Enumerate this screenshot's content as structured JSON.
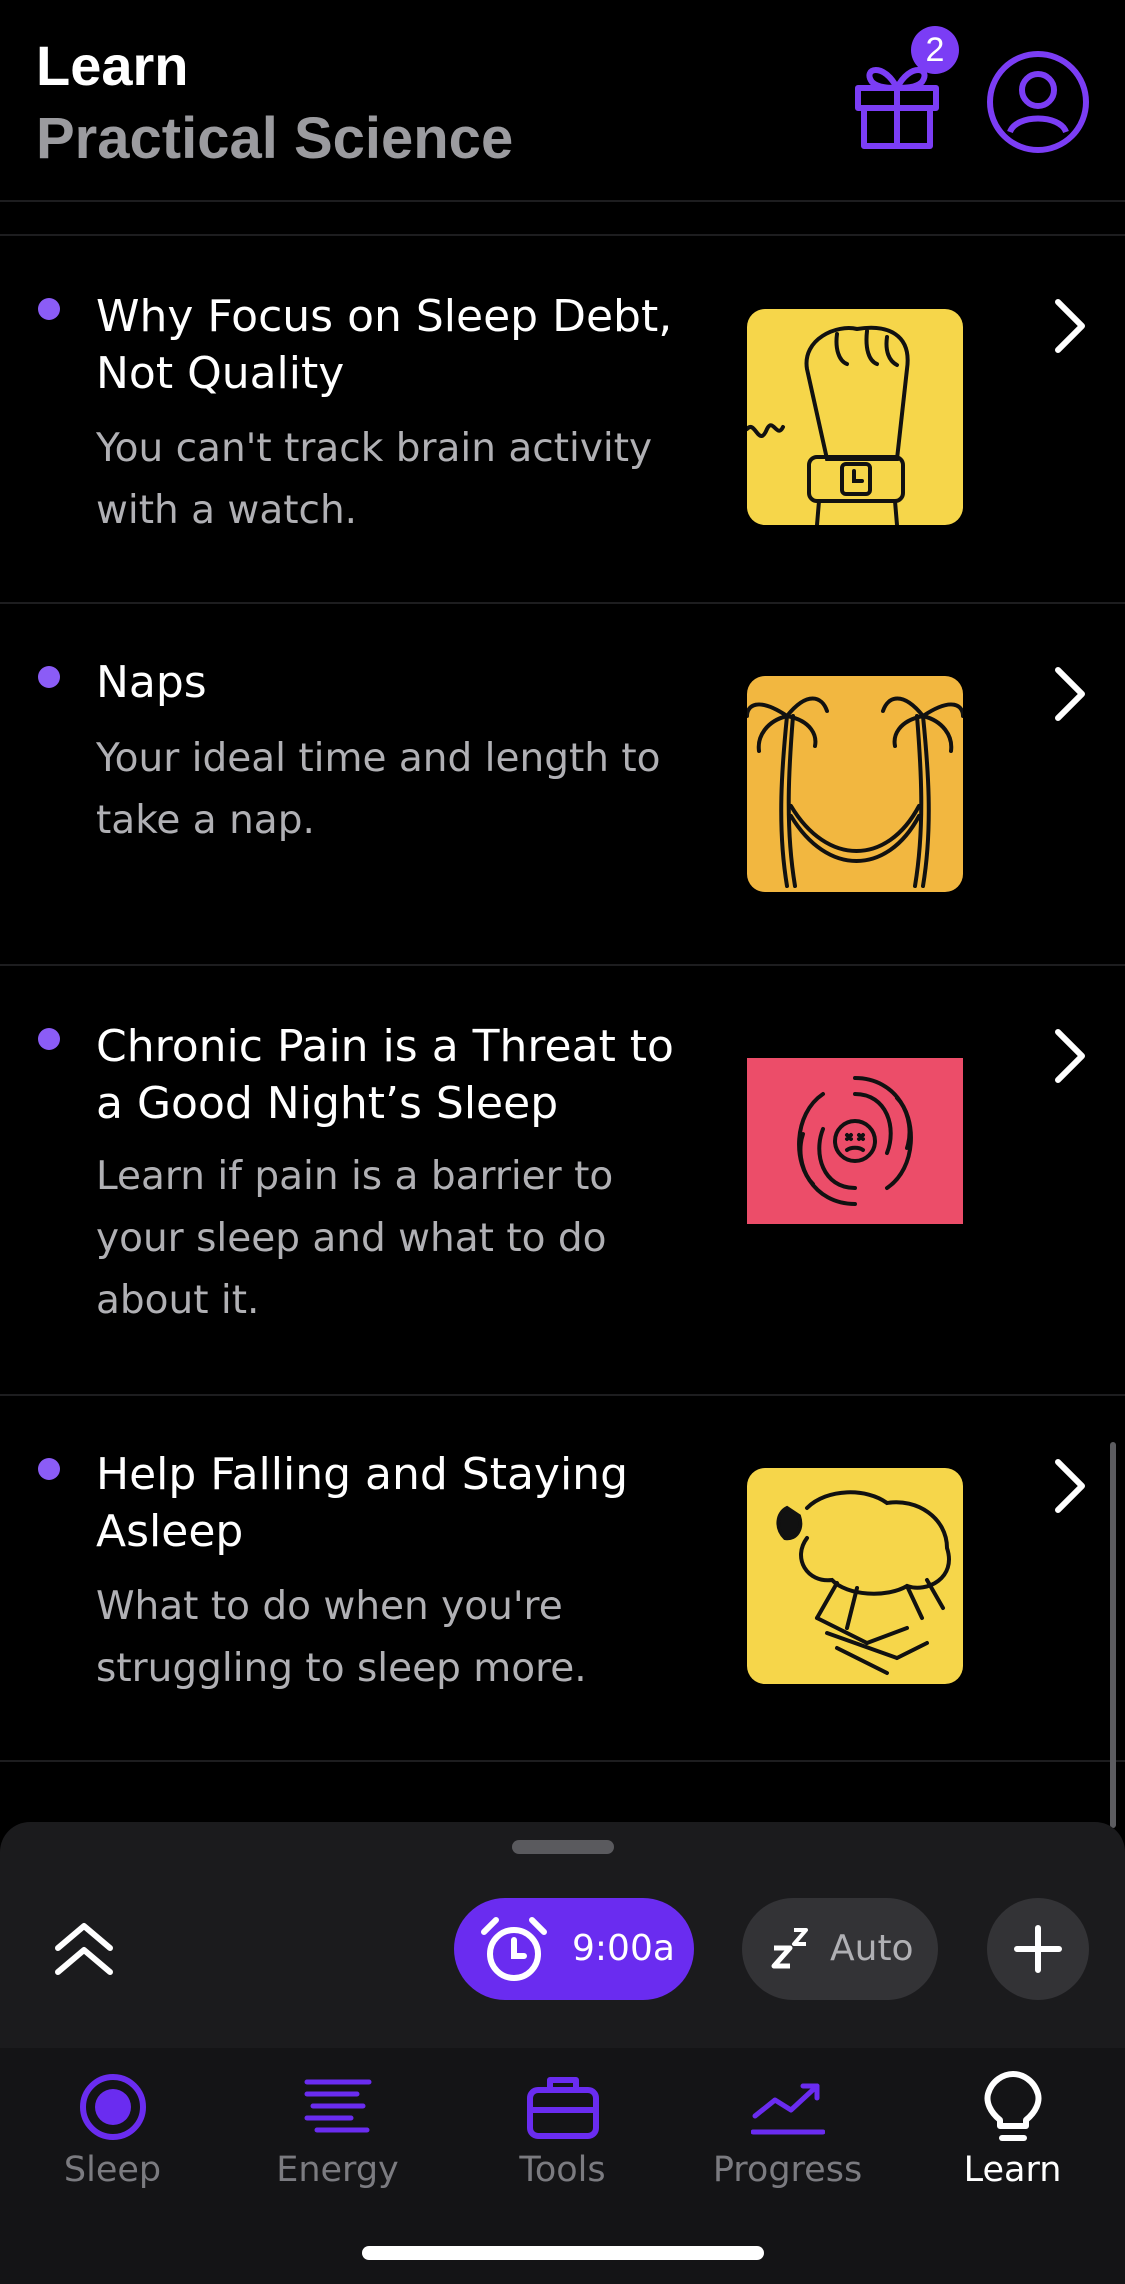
{
  "header": {
    "title": "Learn",
    "subtitle": "Practical Science",
    "gift_badge": "2",
    "accent_color": "#7b3df5"
  },
  "articles": [
    {
      "title": "Why Focus on Sleep Debt, Not Quality",
      "description": "You can't track brain activity with a watch.",
      "thumbnail_icon": "wrist-watch-illustration",
      "thumbnail_color": "#f6d64a"
    },
    {
      "title": "Naps",
      "description": "Your ideal time and length to take a nap.",
      "thumbnail_icon": "hammock-palm-trees-illustration",
      "thumbnail_color": "#f2b740"
    },
    {
      "title": "Chronic Pain is a Threat to a Good Night’s Sleep",
      "description": "Learn if pain is a barrier to your sleep and what to do about it.",
      "thumbnail_icon": "pain-swirl-illustration",
      "thumbnail_color": "#ec4d69"
    },
    {
      "title": "Help Falling and Staying Asleep",
      "description": "What to do when you're struggling to sleep more.",
      "thumbnail_icon": "jumping-sheep-illustration",
      "thumbnail_color": "#f6d64a"
    }
  ],
  "quick_bar": {
    "alarm_time": "9:00a",
    "sleep_mode": "Auto",
    "alarm_color": "#6a2cf0"
  },
  "tabs": [
    {
      "label": "Sleep",
      "icon": "sleep-target-icon"
    },
    {
      "label": "Energy",
      "icon": "energy-lines-icon"
    },
    {
      "label": "Tools",
      "icon": "briefcase-icon"
    },
    {
      "label": "Progress",
      "icon": "trend-line-icon"
    },
    {
      "label": "Learn",
      "icon": "lightbulb-icon",
      "active": true
    }
  ]
}
